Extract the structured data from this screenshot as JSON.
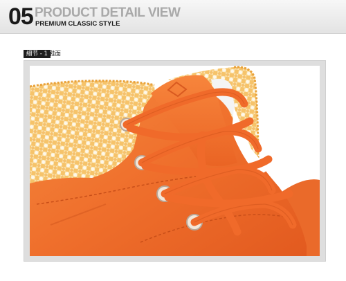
{
  "header": {
    "number": "05",
    "title": "PRODUCT DETAIL VIEW",
    "subtitle": "PREMIUM CLASSIC STYLE"
  },
  "detail": {
    "tag": "細节 - 1",
    "label": "鞋面"
  },
  "photo": {
    "icons": [
      "shoe-photo"
    ],
    "colors": {
      "upper": "#f0722d",
      "lace": "#ef6a2b",
      "collar_check": "#f4b84a",
      "background": "#ffffff"
    }
  }
}
